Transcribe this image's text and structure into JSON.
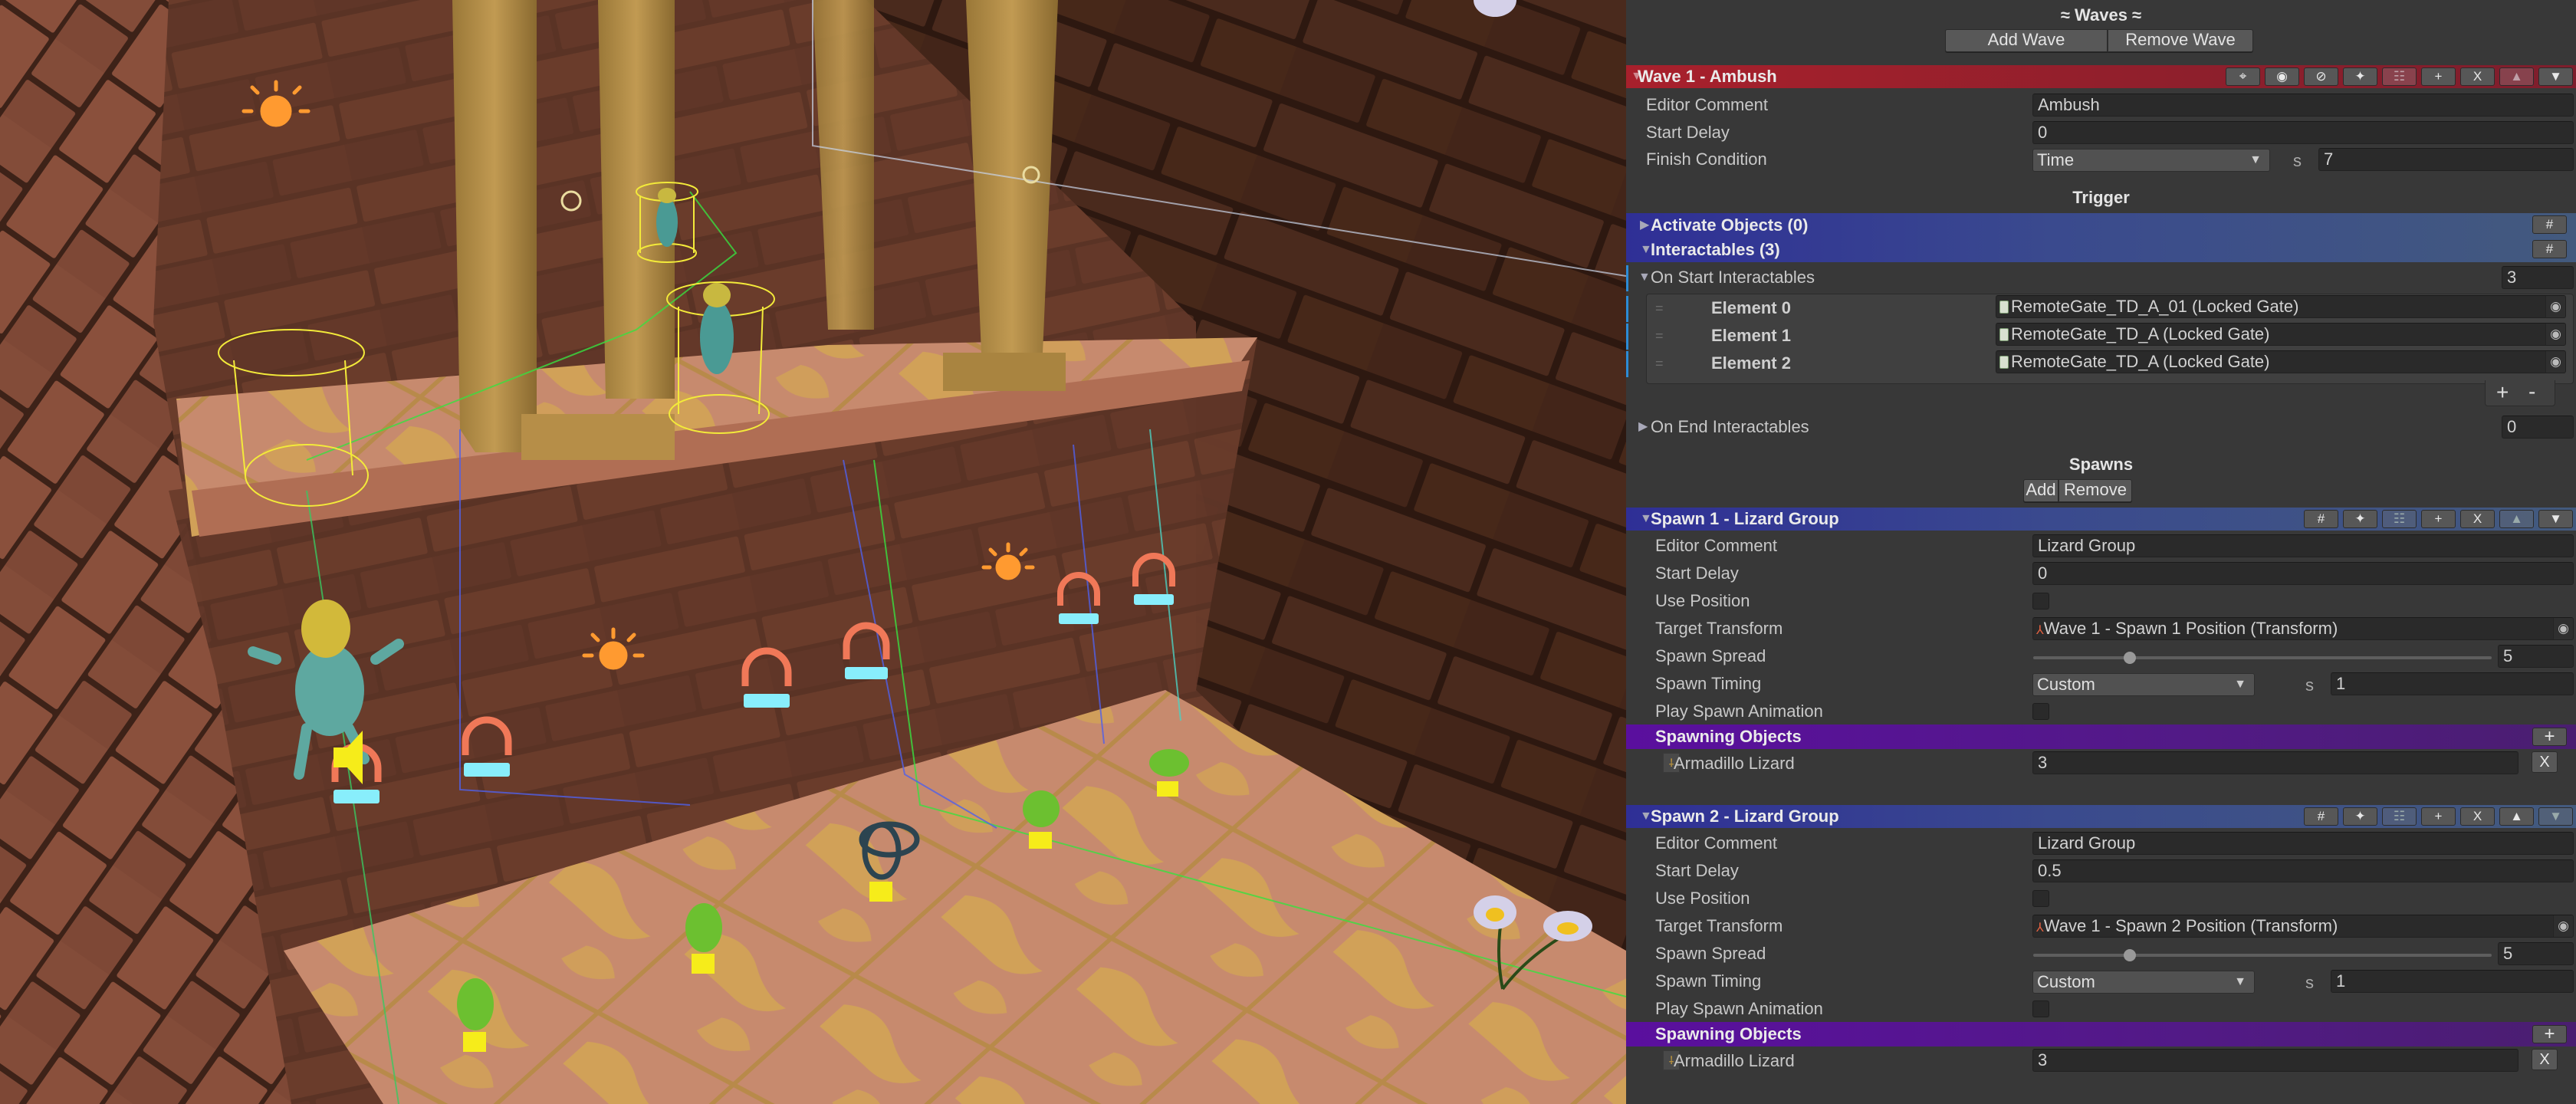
{
  "scene_view": {
    "gizmo_icons": [
      "light-bulb-icon",
      "sun-icon",
      "gate-icon",
      "speaker-icon",
      "spawn-point-icon",
      "vortex-icon"
    ],
    "objects": [
      "lizard-enemy",
      "stone-pillar",
      "daisy-flower",
      "green-pickup"
    ]
  },
  "inspector": {
    "waves_title": "≈ Waves ≈",
    "add_wave": "Add Wave",
    "remove_wave": "Remove Wave",
    "wave": {
      "title": "Wave 1 - Ambush",
      "header_buttons": [
        {
          "name": "focus-button",
          "glyph": "⌖"
        },
        {
          "name": "show-button",
          "glyph": "◉"
        },
        {
          "name": "hide-button",
          "glyph": "⊘"
        },
        {
          "name": "select-button",
          "glyph": "✦"
        },
        {
          "name": "paste-button",
          "glyph": "☷"
        },
        {
          "name": "add-button",
          "glyph": "+"
        },
        {
          "name": "delete-button",
          "glyph": "X"
        },
        {
          "name": "move-up-button",
          "glyph": "▲"
        },
        {
          "name": "move-down-button",
          "glyph": "▼"
        }
      ],
      "editor_comment_label": "Editor Comment",
      "editor_comment": "Ambush",
      "start_delay_label": "Start Delay",
      "start_delay": "0",
      "finish_condition_label": "Finish Condition",
      "finish_condition": "Time",
      "finish_unit": "s",
      "finish_value": "7"
    },
    "trigger": {
      "title": "Trigger",
      "activate_objects": "Activate Objects (0)",
      "interactables": "Interactables (3)",
      "hash_glyph": "#",
      "on_start_label": "On Start Interactables",
      "on_start_count": "3",
      "elements": [
        {
          "label": "Element 0",
          "value": "RemoteGate_TD_A_01 (Locked Gate)"
        },
        {
          "label": "Element 1",
          "value": "RemoteGate_TD_A (Locked Gate)"
        },
        {
          "label": "Element 2",
          "value": "RemoteGate_TD_A (Locked Gate)"
        }
      ],
      "add_glyph": "+",
      "remove_glyph": "-",
      "on_end_label": "On End Interactables",
      "on_end_count": "0"
    },
    "spawns_title": "Spawns",
    "add_spawn": "Add",
    "remove_spawn": "Remove",
    "spawns": [
      {
        "title": "Spawn 1 - Lizard Group",
        "header_buttons": [
          {
            "name": "hash-button",
            "glyph": "#"
          },
          {
            "name": "select-button",
            "glyph": "✦"
          },
          {
            "name": "paste-button",
            "glyph": "☷"
          },
          {
            "name": "add-button",
            "glyph": "+"
          },
          {
            "name": "delete-button",
            "glyph": "X"
          },
          {
            "name": "move-up-button",
            "glyph": "▲"
          },
          {
            "name": "move-down-button",
            "glyph": "▼"
          }
        ],
        "editor_comment_label": "Editor Comment",
        "editor_comment": "Lizard Group",
        "start_delay_label": "Start Delay",
        "start_delay": "0",
        "use_position_label": "Use Position",
        "use_position": false,
        "target_transform_label": "Target Transform",
        "target_transform": "Wave 1 - Spawn 1 Position (Transform)",
        "spawn_spread_label": "Spawn Spread",
        "spawn_spread": "5",
        "spawn_spread_fraction": 0.21,
        "spawn_timing_label": "Spawn Timing",
        "spawn_timing": "Custom",
        "spawn_timing_unit": "s",
        "spawn_timing_value": "1",
        "play_anim_label": "Play Spawn Animation",
        "play_anim": false,
        "spawning_objects_label": "Spawning Objects",
        "objects": [
          {
            "name": "Armadillo Lizard",
            "count": "3"
          }
        ]
      },
      {
        "title": "Spawn 2 - Lizard Group",
        "header_buttons": [
          {
            "name": "hash-button",
            "glyph": "#"
          },
          {
            "name": "select-button",
            "glyph": "✦"
          },
          {
            "name": "paste-button",
            "glyph": "☷"
          },
          {
            "name": "add-button",
            "glyph": "+"
          },
          {
            "name": "delete-button",
            "glyph": "X"
          },
          {
            "name": "move-up-button",
            "glyph": "▲"
          },
          {
            "name": "move-down-button",
            "glyph": "▼"
          }
        ],
        "editor_comment_label": "Editor Comment",
        "editor_comment": "Lizard Group",
        "start_delay_label": "Start Delay",
        "start_delay": "0.5",
        "use_position_label": "Use Position",
        "use_position": false,
        "target_transform_label": "Target Transform",
        "target_transform": "Wave 1 - Spawn 2 Position (Transform)",
        "spawn_spread_label": "Spawn Spread",
        "spawn_spread": "5",
        "spawn_spread_fraction": 0.21,
        "spawn_timing_label": "Spawn Timing",
        "spawn_timing": "Custom",
        "spawn_timing_unit": "s",
        "spawn_timing_value": "1",
        "play_anim_label": "Play Spawn Animation",
        "play_anim": false,
        "spawning_objects_label": "Spawning Objects",
        "objects": [
          {
            "name": "Armadillo Lizard",
            "count": "3"
          }
        ]
      }
    ],
    "colors": {
      "wave_header": "#a8202c",
      "group_header": "#3a4a8e",
      "spawning_objects_header": "#5a0f9e",
      "modified_marker": "#2c8bd6"
    }
  }
}
